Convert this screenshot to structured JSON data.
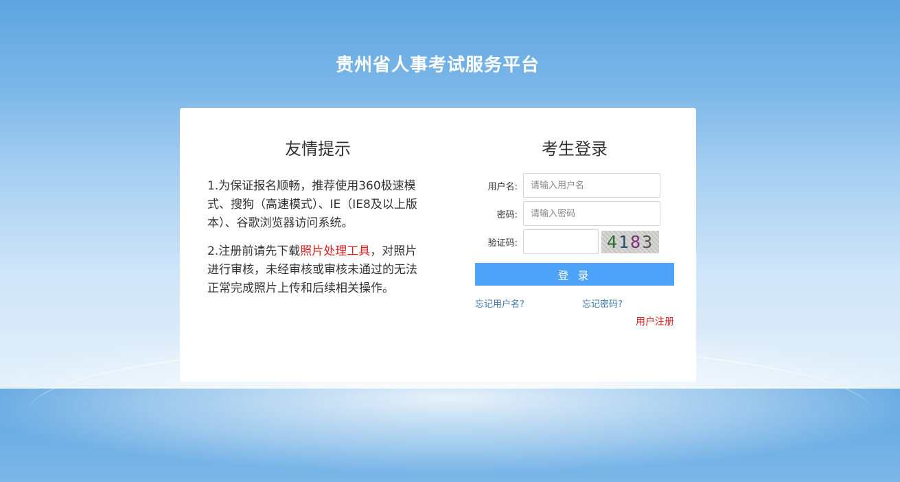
{
  "site": {
    "title": "贵州省人事考试服务平台"
  },
  "tips": {
    "title": "友情提示",
    "item1": "1.为保证报名顺畅，推荐使用360极速模式、搜狗（高速模式）、IE（IE8及以上版本）、谷歌浏览器访问系统。",
    "item2_prefix": "2.注册前请先下载",
    "item2_link": "照片处理工具",
    "item2_suffix": "，对照片进行审核，未经审核或审核未通过的无法正常完成照片上传和后续相关操作。"
  },
  "login": {
    "title": "考生登录",
    "username_label": "用户名:",
    "username_placeholder": "请输入用户名",
    "password_label": "密码:",
    "password_placeholder": "请输入密码",
    "captcha_label": "验证码:",
    "captcha_text": [
      "4",
      "1",
      "8",
      "3"
    ],
    "submit_label": "登 录",
    "forgot_username": "忘记用户名?",
    "forgot_password": "忘记密码?",
    "register": "用户注册"
  },
  "colors": {
    "primary_button": "#4da3f8",
    "link": "#3b78b0",
    "highlight_red": "#e02020"
  }
}
